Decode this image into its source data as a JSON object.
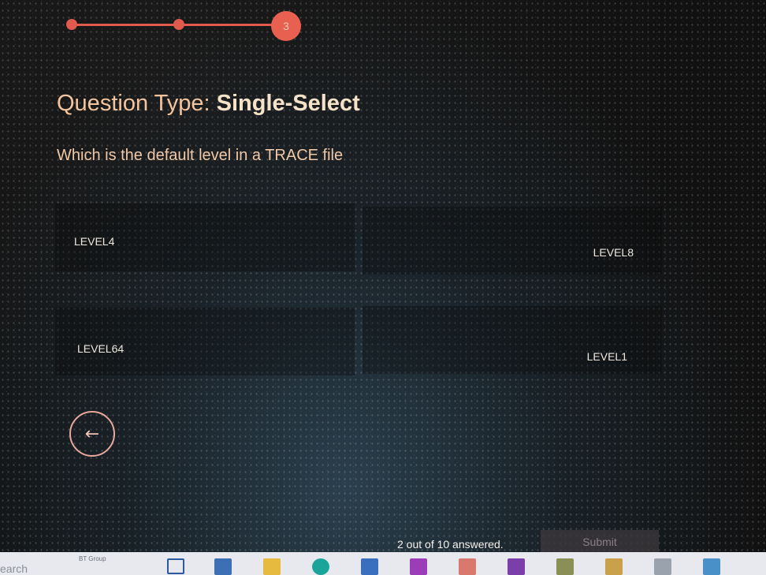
{
  "progress": {
    "current_step": "3"
  },
  "question": {
    "type_label": "Question Type:",
    "type_value": "Single-Select",
    "text": "Which is the default level in a TRACE file"
  },
  "options": [
    {
      "label": "LEVEL4"
    },
    {
      "label": "LEVEL8"
    },
    {
      "label": "LEVEL64"
    },
    {
      "label": "LEVEL1"
    }
  ],
  "footer": {
    "answered_count": "2 out of 10 answered.",
    "submit_label": "Submit"
  },
  "taskbar": {
    "search_text": "earch",
    "org_label": "BT Group"
  },
  "colors": {
    "accent": "#e05a4e",
    "background": "#141618"
  }
}
